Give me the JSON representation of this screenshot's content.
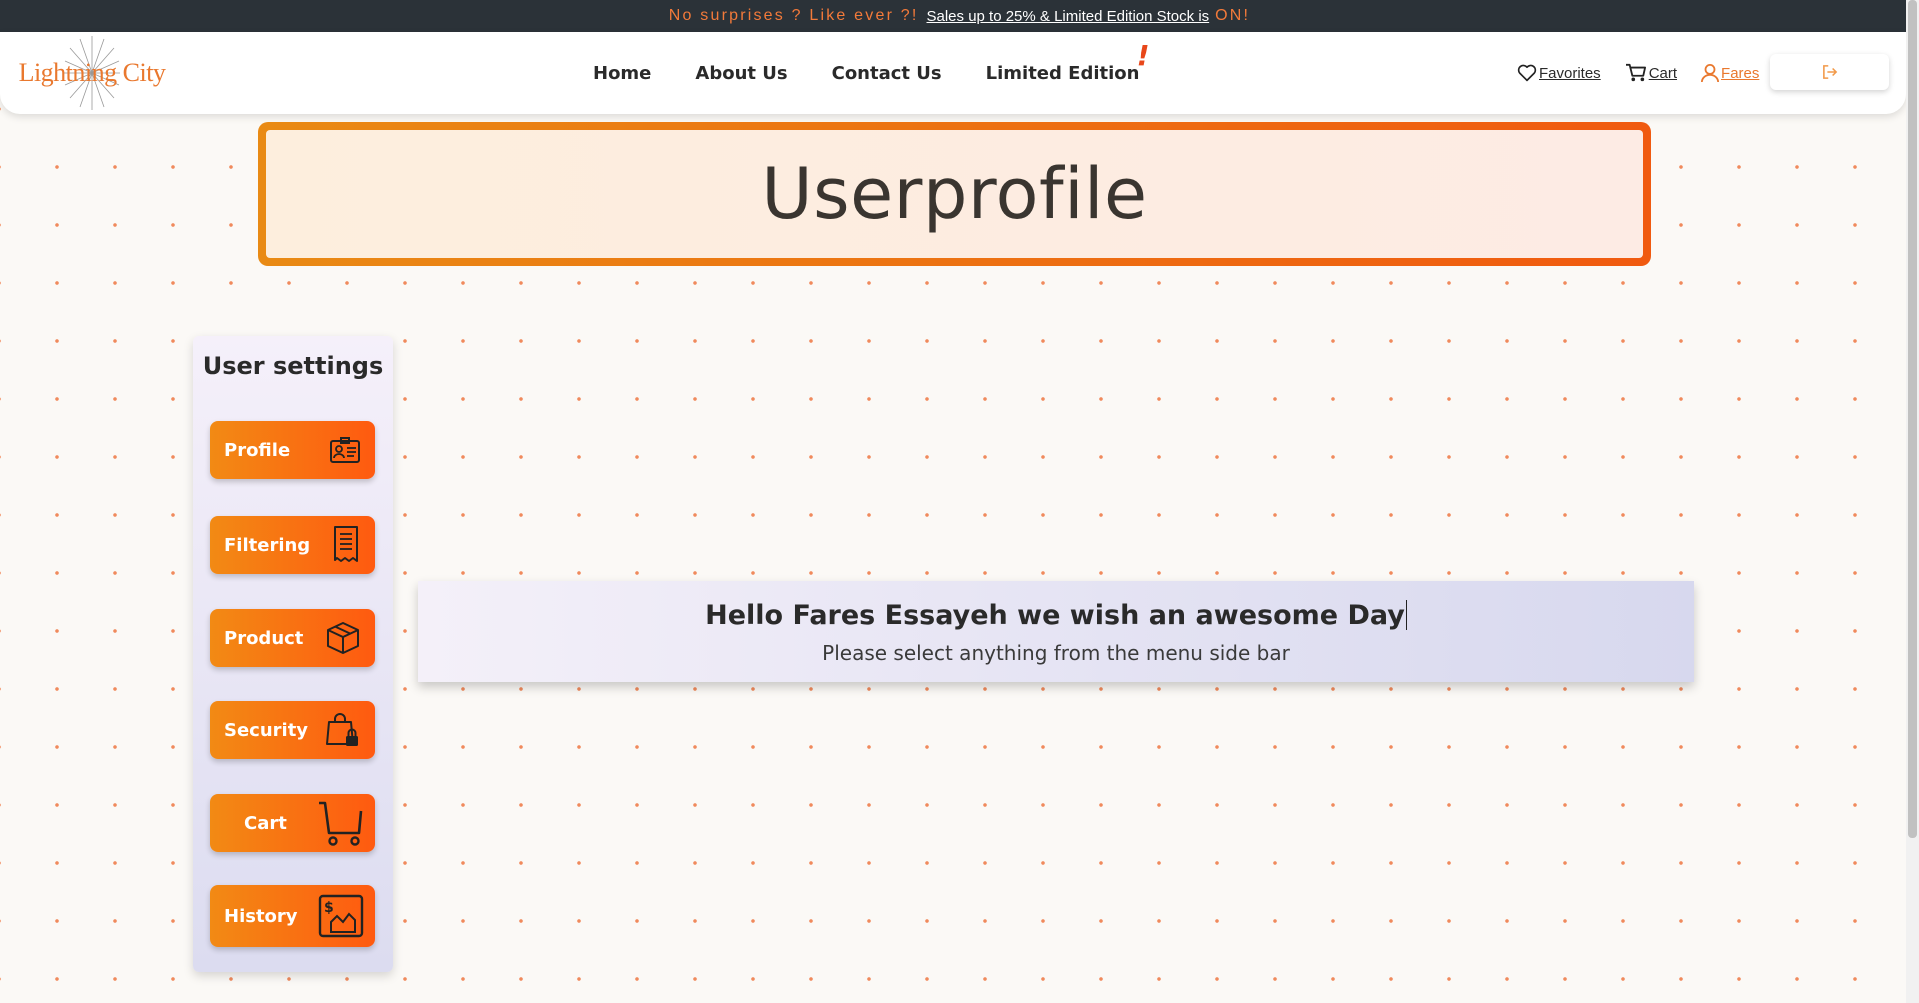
{
  "promo": {
    "prefix": "No surprises ? Like ever ?!",
    "link": "Sales up to 25% & Limited Edition Stock is",
    "suffix": "ON!"
  },
  "header": {
    "logo_text": "Lightning City",
    "nav": [
      "Home",
      "About Us",
      "Contact Us",
      "Limited Edition"
    ],
    "limited_badge": "!",
    "favorites": "Favorites",
    "cart": "Cart",
    "user": "Fares"
  },
  "banner": {
    "title": "Userprofile"
  },
  "sidebar": {
    "title": "User settings",
    "items": [
      {
        "label": "Profile",
        "icon": "id-card-icon"
      },
      {
        "label": "Filtering",
        "icon": "receipt-icon"
      },
      {
        "label": "Product",
        "icon": "box-icon"
      },
      {
        "label": "Security",
        "icon": "lock-bag-icon"
      },
      {
        "label": "Cart",
        "icon": "cart-icon"
      },
      {
        "label": "History",
        "icon": "money-history-icon"
      }
    ]
  },
  "greeting": {
    "title": "Hello Fares Essayeh we wish an awesome Day",
    "subtitle": "Please select anything from the menu side bar"
  },
  "colors": {
    "accent": "#f37a3a",
    "button_start": "#f28a14",
    "button_end": "#ff5a10",
    "promo_bg": "#2b3238"
  }
}
